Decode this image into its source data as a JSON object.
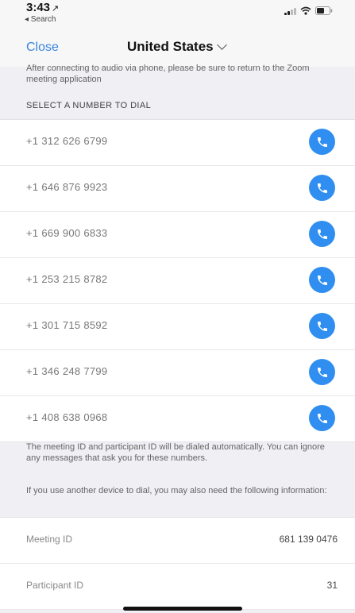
{
  "status_bar": {
    "time": "3:43",
    "location_arrow": "↗",
    "back_app": "◂ Search",
    "icons": [
      "signal-icon",
      "wifi-icon",
      "battery-icon"
    ]
  },
  "nav": {
    "close_label": "Close",
    "country": "United States"
  },
  "top_note": "After connecting to audio via phone, please be sure to return to the Zoom meeting application",
  "section_header": "SELECT A NUMBER TO DIAL",
  "numbers": [
    {
      "number": "+1 312 626 6799"
    },
    {
      "number": "+1 646 876 9923"
    },
    {
      "number": "+1 669 900 6833"
    },
    {
      "number": "+1 253 215 8782"
    },
    {
      "number": "+1 301 715 8592"
    },
    {
      "number": "+1 346 248 7799"
    },
    {
      "number": "+1 408 638 0968"
    }
  ],
  "auto_dial_note": "The meeting ID and participant ID will be dialed automatically. You can ignore any messages that ask you for these numbers.",
  "other_device_note": "If you use another device to dial, you may also need the following information:",
  "info": {
    "meeting_id_label": "Meeting ID",
    "meeting_id_value": "681 139 0476",
    "participant_id_label": "Participant ID",
    "participant_id_value": "31"
  },
  "colors": {
    "accent": "#3a86e0",
    "call_button": "#2f8ef0",
    "background": "#efeff4"
  }
}
